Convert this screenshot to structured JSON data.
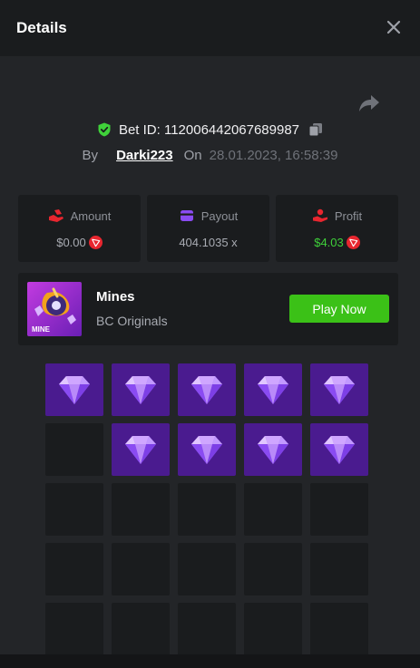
{
  "header": {
    "title": "Details"
  },
  "bet": {
    "id_label": "Bet ID: 112006442067689987",
    "by_label": "By",
    "user": "Darki223",
    "on_label": "On",
    "date": "28.01.2023, 16:58:39"
  },
  "stats": {
    "amount": {
      "label": "Amount",
      "value": "$0.00"
    },
    "payout": {
      "label": "Payout",
      "value": "404.1035 x"
    },
    "profit": {
      "label": "Profit",
      "value": "$4.03"
    }
  },
  "game": {
    "name": "Mines",
    "provider": "BC Originals",
    "thumb_text": "MINE",
    "play_label": "Play Now"
  },
  "board": {
    "columns": 5,
    "rows_visible": 5,
    "cells": [
      "gem",
      "gem",
      "gem",
      "gem",
      "gem",
      "empty",
      "gem",
      "gem",
      "gem",
      "gem",
      "empty",
      "empty",
      "empty",
      "empty",
      "empty",
      "empty",
      "empty",
      "empty",
      "empty",
      "empty",
      "empty",
      "empty",
      "empty",
      "empty",
      "empty"
    ]
  },
  "colors": {
    "accent_green": "#3bc117",
    "profit_green": "#3fd13a",
    "gem_tile": "#4a1b8f",
    "tron_red": "#e8262f"
  },
  "icons": {
    "close": "close-icon",
    "share": "share-icon",
    "verified": "shield-check-icon",
    "copy": "copy-icon",
    "amount": "coins-hand-icon",
    "payout": "wallet-icon",
    "profit": "profit-icon",
    "currency": "trx-icon",
    "gem": "diamond-icon"
  }
}
